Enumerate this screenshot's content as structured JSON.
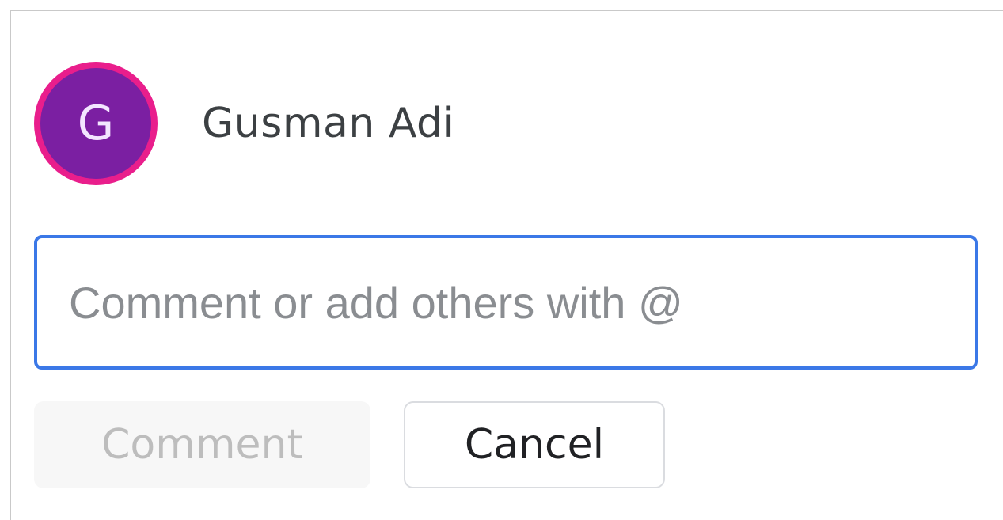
{
  "user": {
    "avatar_letter": "G",
    "name": "Gusman Adi",
    "avatar_ring_color": "#e91e8c",
    "avatar_fill_color": "#7b1fa2"
  },
  "comment_box": {
    "value": "",
    "placeholder": "Comment or add others with @",
    "focus_color": "#3b78e7"
  },
  "actions": {
    "comment_label": "Comment",
    "cancel_label": "Cancel",
    "comment_disabled": true
  }
}
